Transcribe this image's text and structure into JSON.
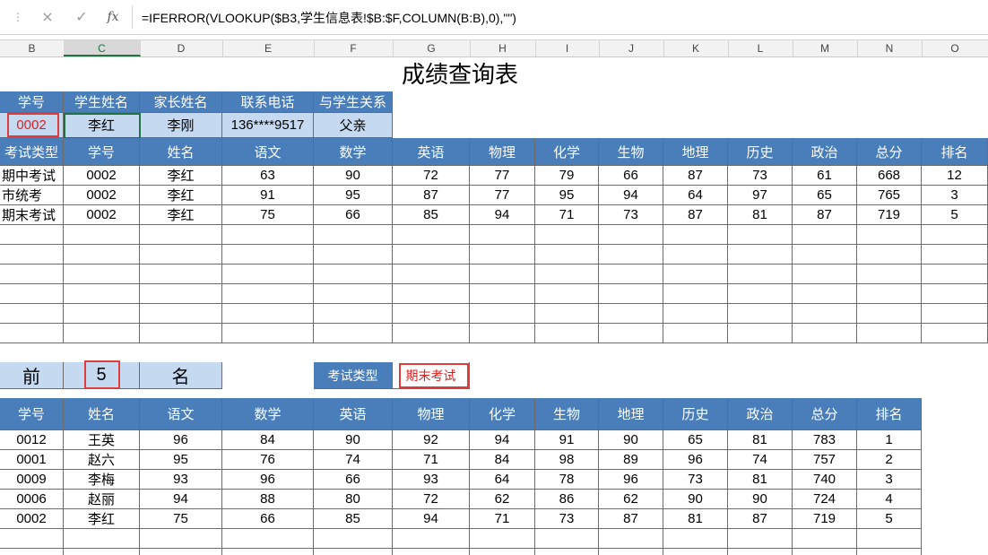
{
  "formula_bar": {
    "cancel_icon": "×",
    "enter_icon": "✓",
    "fx_label": "fx",
    "formula": "=IFERROR(VLOOKUP($B3,学生信息表!$B:$F,COLUMN(B:B),0),\"\")"
  },
  "columns": [
    "B",
    "C",
    "D",
    "E",
    "F",
    "G",
    "H",
    "I",
    "J",
    "K",
    "L",
    "M",
    "N",
    "O"
  ],
  "selected_column": "C",
  "title": "成绩查询表",
  "student_info": {
    "headers": [
      "学号",
      "学生姓名",
      "家长姓名",
      "联系电话",
      "与学生关系"
    ],
    "values": [
      "0002",
      "李红",
      "李刚",
      "136****9517",
      "父亲"
    ]
  },
  "scores": {
    "headers": [
      "考试类型",
      "学号",
      "姓名",
      "语文",
      "数学",
      "英语",
      "物理",
      "化学",
      "生物",
      "地理",
      "历史",
      "政治",
      "总分",
      "排名"
    ],
    "rows": [
      [
        "期中考试",
        "0002",
        "李红",
        "63",
        "90",
        "72",
        "77",
        "79",
        "66",
        "87",
        "73",
        "61",
        "668",
        "12"
      ],
      [
        "市统考",
        "0002",
        "李红",
        "91",
        "95",
        "87",
        "77",
        "95",
        "94",
        "64",
        "97",
        "65",
        "765",
        "3"
      ],
      [
        "期末考试",
        "0002",
        "李红",
        "75",
        "66",
        "85",
        "94",
        "71",
        "73",
        "87",
        "81",
        "87",
        "719",
        "5"
      ]
    ],
    "empty_rows": 6
  },
  "top_n": {
    "prefix": "前",
    "value": "5",
    "suffix": "名",
    "exam_type_label": "考试类型",
    "exam_type_value": "期末考试"
  },
  "ranking": {
    "headers": [
      "学号",
      "姓名",
      "语文",
      "数学",
      "英语",
      "物理",
      "化学",
      "生物",
      "地理",
      "历史",
      "政治",
      "总分",
      "排名"
    ],
    "rows": [
      [
        "0012",
        "王英",
        "96",
        "84",
        "90",
        "92",
        "94",
        "91",
        "90",
        "65",
        "81",
        "783",
        "1"
      ],
      [
        "0001",
        "赵六",
        "95",
        "76",
        "74",
        "71",
        "84",
        "98",
        "89",
        "96",
        "74",
        "757",
        "2"
      ],
      [
        "0009",
        "李梅",
        "93",
        "96",
        "66",
        "93",
        "64",
        "78",
        "96",
        "73",
        "81",
        "740",
        "3"
      ],
      [
        "0006",
        "赵丽",
        "94",
        "88",
        "80",
        "72",
        "62",
        "86",
        "62",
        "90",
        "90",
        "724",
        "4"
      ],
      [
        "0002",
        "李红",
        "75",
        "66",
        "85",
        "94",
        "71",
        "73",
        "87",
        "81",
        "87",
        "719",
        "5"
      ]
    ],
    "empty_rows": 1
  },
  "colors": {
    "header_blue": "#4a7ebb",
    "light_blue": "#c5d9f1",
    "highlight_red": "#e03c3c",
    "excel_green": "#217346"
  }
}
